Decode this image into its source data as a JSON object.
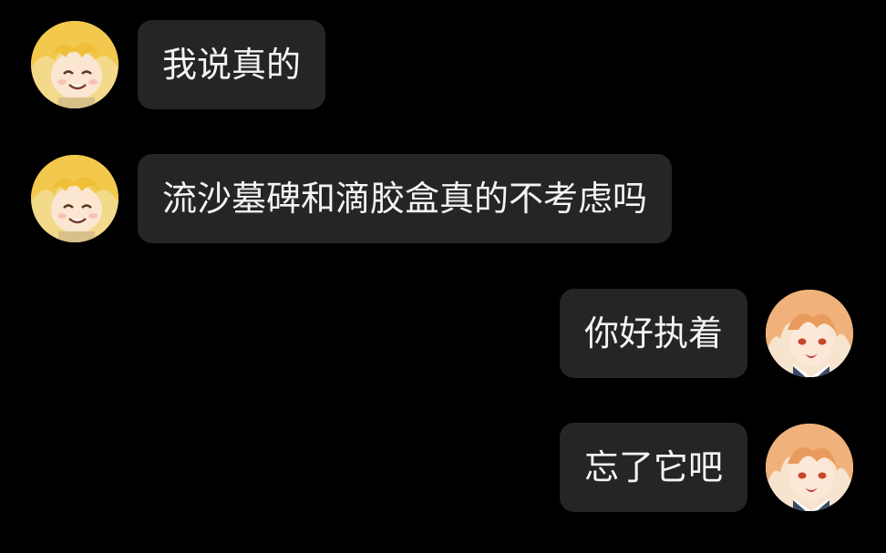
{
  "theme": {
    "background": "#000000",
    "bubble_color": "#252525",
    "text_color": "#f4f4f4"
  },
  "messages": [
    {
      "sender": "left",
      "avatar_icon": "blonde-chibi-avatar-icon",
      "text": "我说真的"
    },
    {
      "sender": "left",
      "avatar_icon": "blonde-chibi-avatar-icon",
      "text": "流沙墓碑和滴胶盒真的不考虑吗"
    },
    {
      "sender": "right",
      "avatar_icon": "orange-hair-avatar-icon",
      "text": "你好执着"
    },
    {
      "sender": "right",
      "avatar_icon": "orange-hair-avatar-icon",
      "text": "忘了它吧"
    }
  ]
}
